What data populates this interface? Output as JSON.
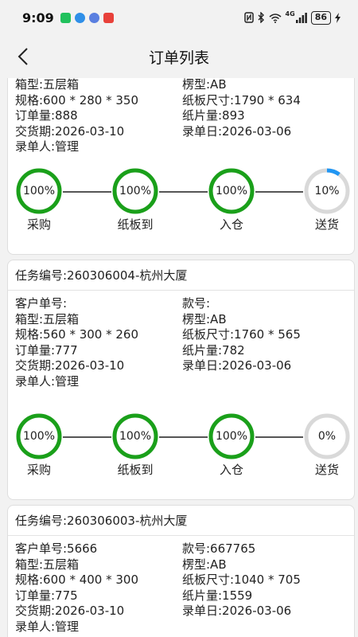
{
  "status_bar": {
    "time": "9:09",
    "battery": "86",
    "network": "4G",
    "signal_icons": [
      "nfc-icon",
      "bluetooth-icon",
      "wifi-icon",
      "signal-icon",
      "charging-icon"
    ],
    "notification_icons": [
      {
        "name": "wechat-notification-icon",
        "color": "#21c15d"
      },
      {
        "name": "app-notification-icon",
        "color": "#2f8fe8"
      },
      {
        "name": "browser-notification-icon",
        "color": "#5a7fe0"
      },
      {
        "name": "red-app-notification-icon",
        "color": "#e8413a"
      }
    ]
  },
  "nav": {
    "title": "订单列表",
    "back_icon": "chevron-left-icon"
  },
  "colors": {
    "complete": "#1aa01a",
    "track": "#d9d9d9",
    "partial": "#2196f3"
  },
  "cards": [
    {
      "header": "",
      "fields_left": [
        "箱型:五层箱",
        "规格:600 * 280 * 350",
        "订单量:888",
        "交货期:2026-03-10",
        "录单人:管理"
      ],
      "fields_right": [
        "楞型:AB",
        "纸板尺寸:1790 * 634",
        "纸片量:893",
        "录单日:2026-03-06",
        ""
      ],
      "stages": [
        {
          "label": "采购",
          "percent": 100,
          "text": "100%"
        },
        {
          "label": "纸板到",
          "percent": 100,
          "text": "100%"
        },
        {
          "label": "入仓",
          "percent": 100,
          "text": "100%"
        },
        {
          "label": "送货",
          "percent": 10,
          "text": "10%"
        }
      ]
    },
    {
      "header": "任务编号:260306004-杭州大厦",
      "fields_left": [
        "客户单号:",
        "箱型:五层箱",
        "规格:560 * 300 * 260",
        "订单量:777",
        "交货期:2026-03-10",
        "录单人:管理"
      ],
      "fields_right": [
        "款号:",
        "楞型:AB",
        "纸板尺寸:1760 * 565",
        "纸片量:782",
        "录单日:2026-03-06",
        ""
      ],
      "stages": [
        {
          "label": "采购",
          "percent": 100,
          "text": "100%"
        },
        {
          "label": "纸板到",
          "percent": 100,
          "text": "100%"
        },
        {
          "label": "入仓",
          "percent": 100,
          "text": "100%"
        },
        {
          "label": "送货",
          "percent": 0,
          "text": "0%"
        }
      ]
    },
    {
      "header": "任务编号:260306003-杭州大厦",
      "fields_left": [
        "客户单号:5666",
        "箱型:五层箱",
        "规格:600 * 400 * 300",
        "订单量:775",
        "交货期:2026-03-10",
        "录单人:管理"
      ],
      "fields_right": [
        "款号:667765",
        "楞型:AB",
        "纸板尺寸:1040 * 705",
        "纸片量:1559",
        "录单日:2026-03-06",
        ""
      ],
      "stages": []
    }
  ]
}
